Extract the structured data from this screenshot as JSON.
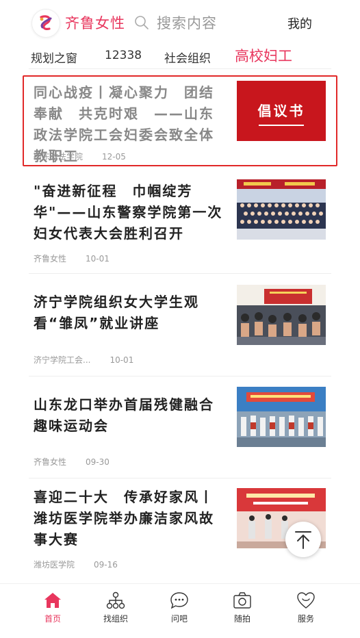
{
  "header": {
    "brand": "齐鲁女性",
    "search_placeholder": "搜索内容",
    "mine": "我的"
  },
  "tabs": [
    {
      "label": "规划之窗",
      "active": false
    },
    {
      "label": "12338",
      "active": false
    },
    {
      "label": "社会组织",
      "active": false
    },
    {
      "label": "高校妇工",
      "active": true
    }
  ],
  "articles": [
    {
      "title": "同心战疫丨凝心聚力　团结奉献　共克时艰　——山东政法学院工会妇委会致全体教职工",
      "source": "山东政法学院",
      "date": "12-05",
      "thumb_text": "倡议书"
    },
    {
      "title": "\"奋进新征程　巾帼绽芳华\"——山东警察学院第一次妇女代表大会胜利召开",
      "source": "齐鲁女性",
      "date": "10-01"
    },
    {
      "title": "济宁学院组织女大学生观看“雏凤”就业讲座",
      "source": "济宁学院工会...",
      "date": "10-01"
    },
    {
      "title": "山东龙口举办首届残健融合趣味运动会",
      "source": "齐鲁女性",
      "date": "09-30"
    },
    {
      "title": "喜迎二十大　传承好家风丨潍坊医学院举办廉洁家风故事大赛",
      "source": "潍坊医学院",
      "date": "09-16"
    }
  ],
  "bottom_nav": [
    {
      "label": "首页",
      "icon": "home-icon",
      "active": true
    },
    {
      "label": "找组织",
      "icon": "org-icon",
      "active": false
    },
    {
      "label": "问吧",
      "icon": "chat-icon",
      "active": false
    },
    {
      "label": "随拍",
      "icon": "camera-icon",
      "active": false
    },
    {
      "label": "服务",
      "icon": "heart-service-icon",
      "active": false
    }
  ],
  "colors": {
    "accent": "#e8365d",
    "highlight_border": "#e12828",
    "proposal_bg": "#c8161d"
  }
}
